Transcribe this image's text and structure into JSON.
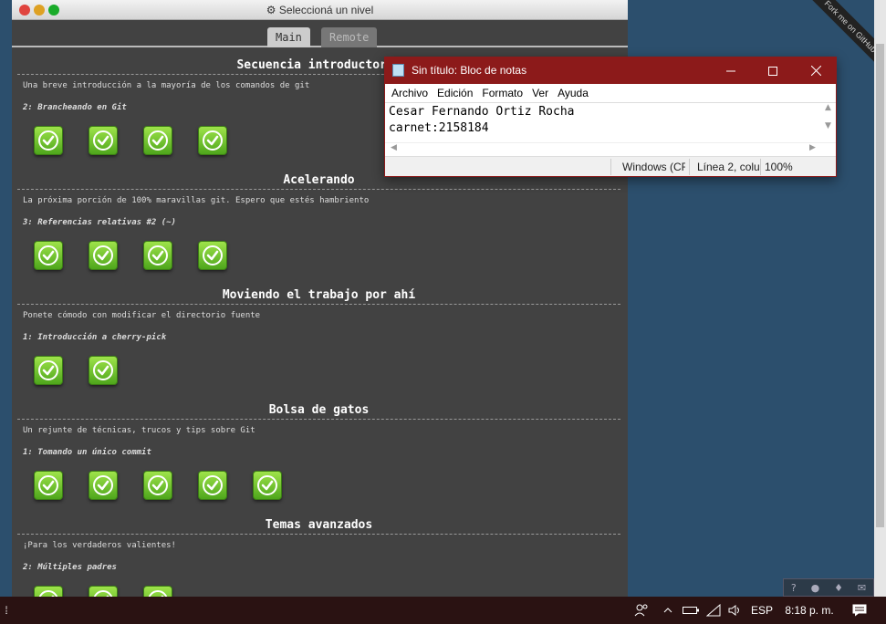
{
  "window": {
    "title": "⚙ Seleccioná un nivel"
  },
  "tabs": [
    {
      "label": "Main"
    },
    {
      "label": "Remote"
    }
  ],
  "sequences": [
    {
      "title": "Secuencia introductoria",
      "desc": "Una breve introducción a la mayoría de los comandos de git",
      "current": "2: Brancheando en Git",
      "levels": 4
    },
    {
      "title": "Acelerando",
      "desc": "La próxima porción de 100% maravillas git. Espero que estés hambriento",
      "current": "3: Referencias relativas #2 (~)",
      "levels": 4
    },
    {
      "title": "Moviendo el trabajo por ahí",
      "desc": "Ponete cómodo con modificar el directorio fuente",
      "current": "1: Introducción a cherry-pick",
      "levels": 2
    },
    {
      "title": "Bolsa de gatos",
      "desc": "Un rejunte de técnicas, trucos y tips sobre Git",
      "current": "1: Tomando un único commit",
      "levels": 5
    },
    {
      "title": "Temas avanzados",
      "desc": "¡Para los verdaderos valientes!",
      "current": "2: Múltiples padres",
      "levels": 3
    }
  ],
  "ribbon": "Fork me on GitHub",
  "notepad": {
    "title": "Sin título: Bloc de notas",
    "menu": [
      "Archivo",
      "Edición",
      "Formato",
      "Ver",
      "Ayuda"
    ],
    "text": "Cesar Fernando Ortiz Rocha\ncarnet:2158184",
    "status": {
      "encoding": "Windows (CR",
      "position": "Línea 2, colu",
      "zoom": "100%"
    }
  },
  "taskbar": {
    "language": "ESP",
    "time": "8:18 p. m."
  },
  "colors": {
    "accent": "#8c1a1a",
    "level_done": "#6cc72a"
  }
}
